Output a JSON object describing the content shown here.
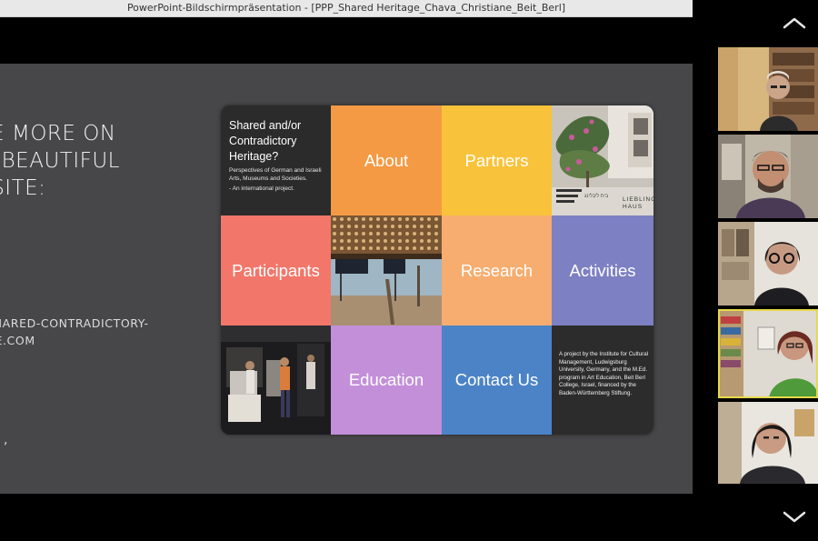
{
  "window": {
    "title": "PowerPoint-Bildschirmpräsentation - [PPP_Shared Heritage_Chava_Christiane_Beit_Berl]"
  },
  "slide": {
    "heading_lines": [
      "SEE MORE ON",
      "UR BEAUTIFUL",
      "EBSITE:"
    ],
    "url_lines": [
      "W.SHARED-CONTRADICTORY-",
      "TAGE.COM"
    ],
    "comma": ","
  },
  "website_grid": {
    "title": "Shared and/or Contradictory Heritage?",
    "subtitle": "Perspectives of German and Israeli Arts, Museums and Societies.",
    "subtitle2": "- An international project.",
    "tiles": {
      "about": "About",
      "partners": "Partners",
      "participants": "Participants",
      "research": "Research",
      "activities": "Activities",
      "education": "Education",
      "contact": "Contact Us"
    },
    "photo_sign_text": "LIEBLING HAUS",
    "project_text": "A project by the Institute for Cultural Management, Ludwigsburg University, Germany, and the M.Ed. program in Art Education, Beit Berl College, Israel, financed by the Baden-Württemberg Stiftung."
  },
  "sidebar": {
    "scroll_up_icon": "chevron-up-icon",
    "scroll_down_icon": "chevron-down-icon",
    "participants_count_visible": 5,
    "active_speaker_index": 4
  },
  "colors": {
    "slide_bg": "#474749",
    "about": "#f49a44",
    "partners": "#f8c33a",
    "participants": "#f2776a",
    "research": "#f6ad6f",
    "activities": "#7d80c2",
    "education": "#c38fd9",
    "contact": "#4c83c6",
    "active_outline": "#e6d94a"
  }
}
